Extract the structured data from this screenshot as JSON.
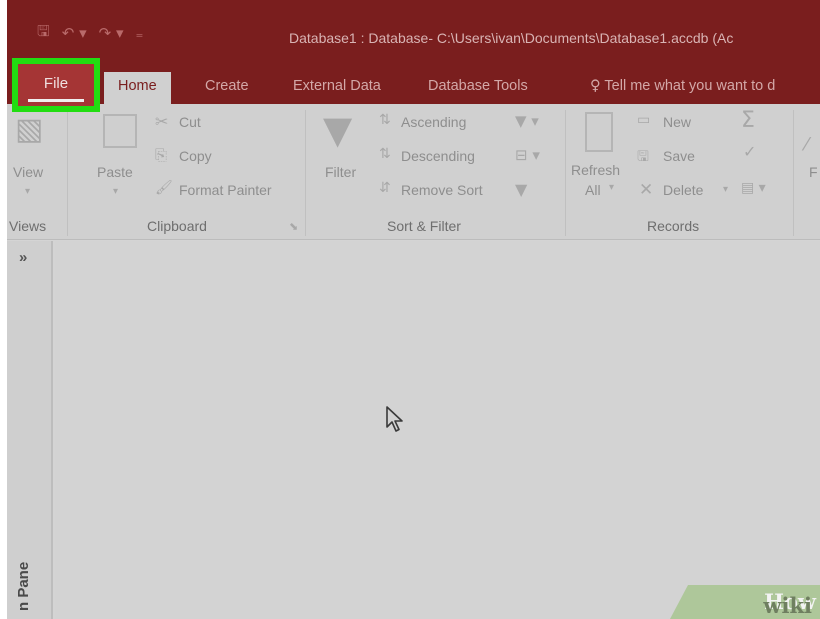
{
  "titlebar": {
    "document_title": "Database1 : Database- C:\\Users\\ivan\\Documents\\Database1.accdb (Ac",
    "qat_icons": [
      "save-icon",
      "undo-icon",
      "redo-icon",
      "customize-icon"
    ]
  },
  "tabs": {
    "file": "File",
    "home": "Home",
    "create": "Create",
    "external_data": "External Data",
    "database_tools": "Database Tools",
    "tell_me": "Tell me what you want to d"
  },
  "ribbon": {
    "views": {
      "view": "View",
      "label": "Views"
    },
    "clipboard": {
      "paste": "Paste",
      "cut": "Cut",
      "copy": "Copy",
      "format_painter": "Format Painter",
      "label": "Clipboard"
    },
    "sort_filter": {
      "filter": "Filter",
      "ascending": "Ascending",
      "descending": "Descending",
      "remove_sort": "Remove Sort",
      "label": "Sort & Filter"
    },
    "records": {
      "refresh": "Refresh",
      "refresh_all": "All",
      "new": "New",
      "save": "Save",
      "delete": "Delete",
      "label": "Records"
    }
  },
  "nav_pane": {
    "toggle": "»",
    "label": "n Pane"
  },
  "watermark": {
    "wiki": "wiki",
    "how": "How"
  },
  "colors": {
    "titlebar": "#7a1e1e",
    "highlight": "#22dd11",
    "file_tab": "#a53535"
  }
}
